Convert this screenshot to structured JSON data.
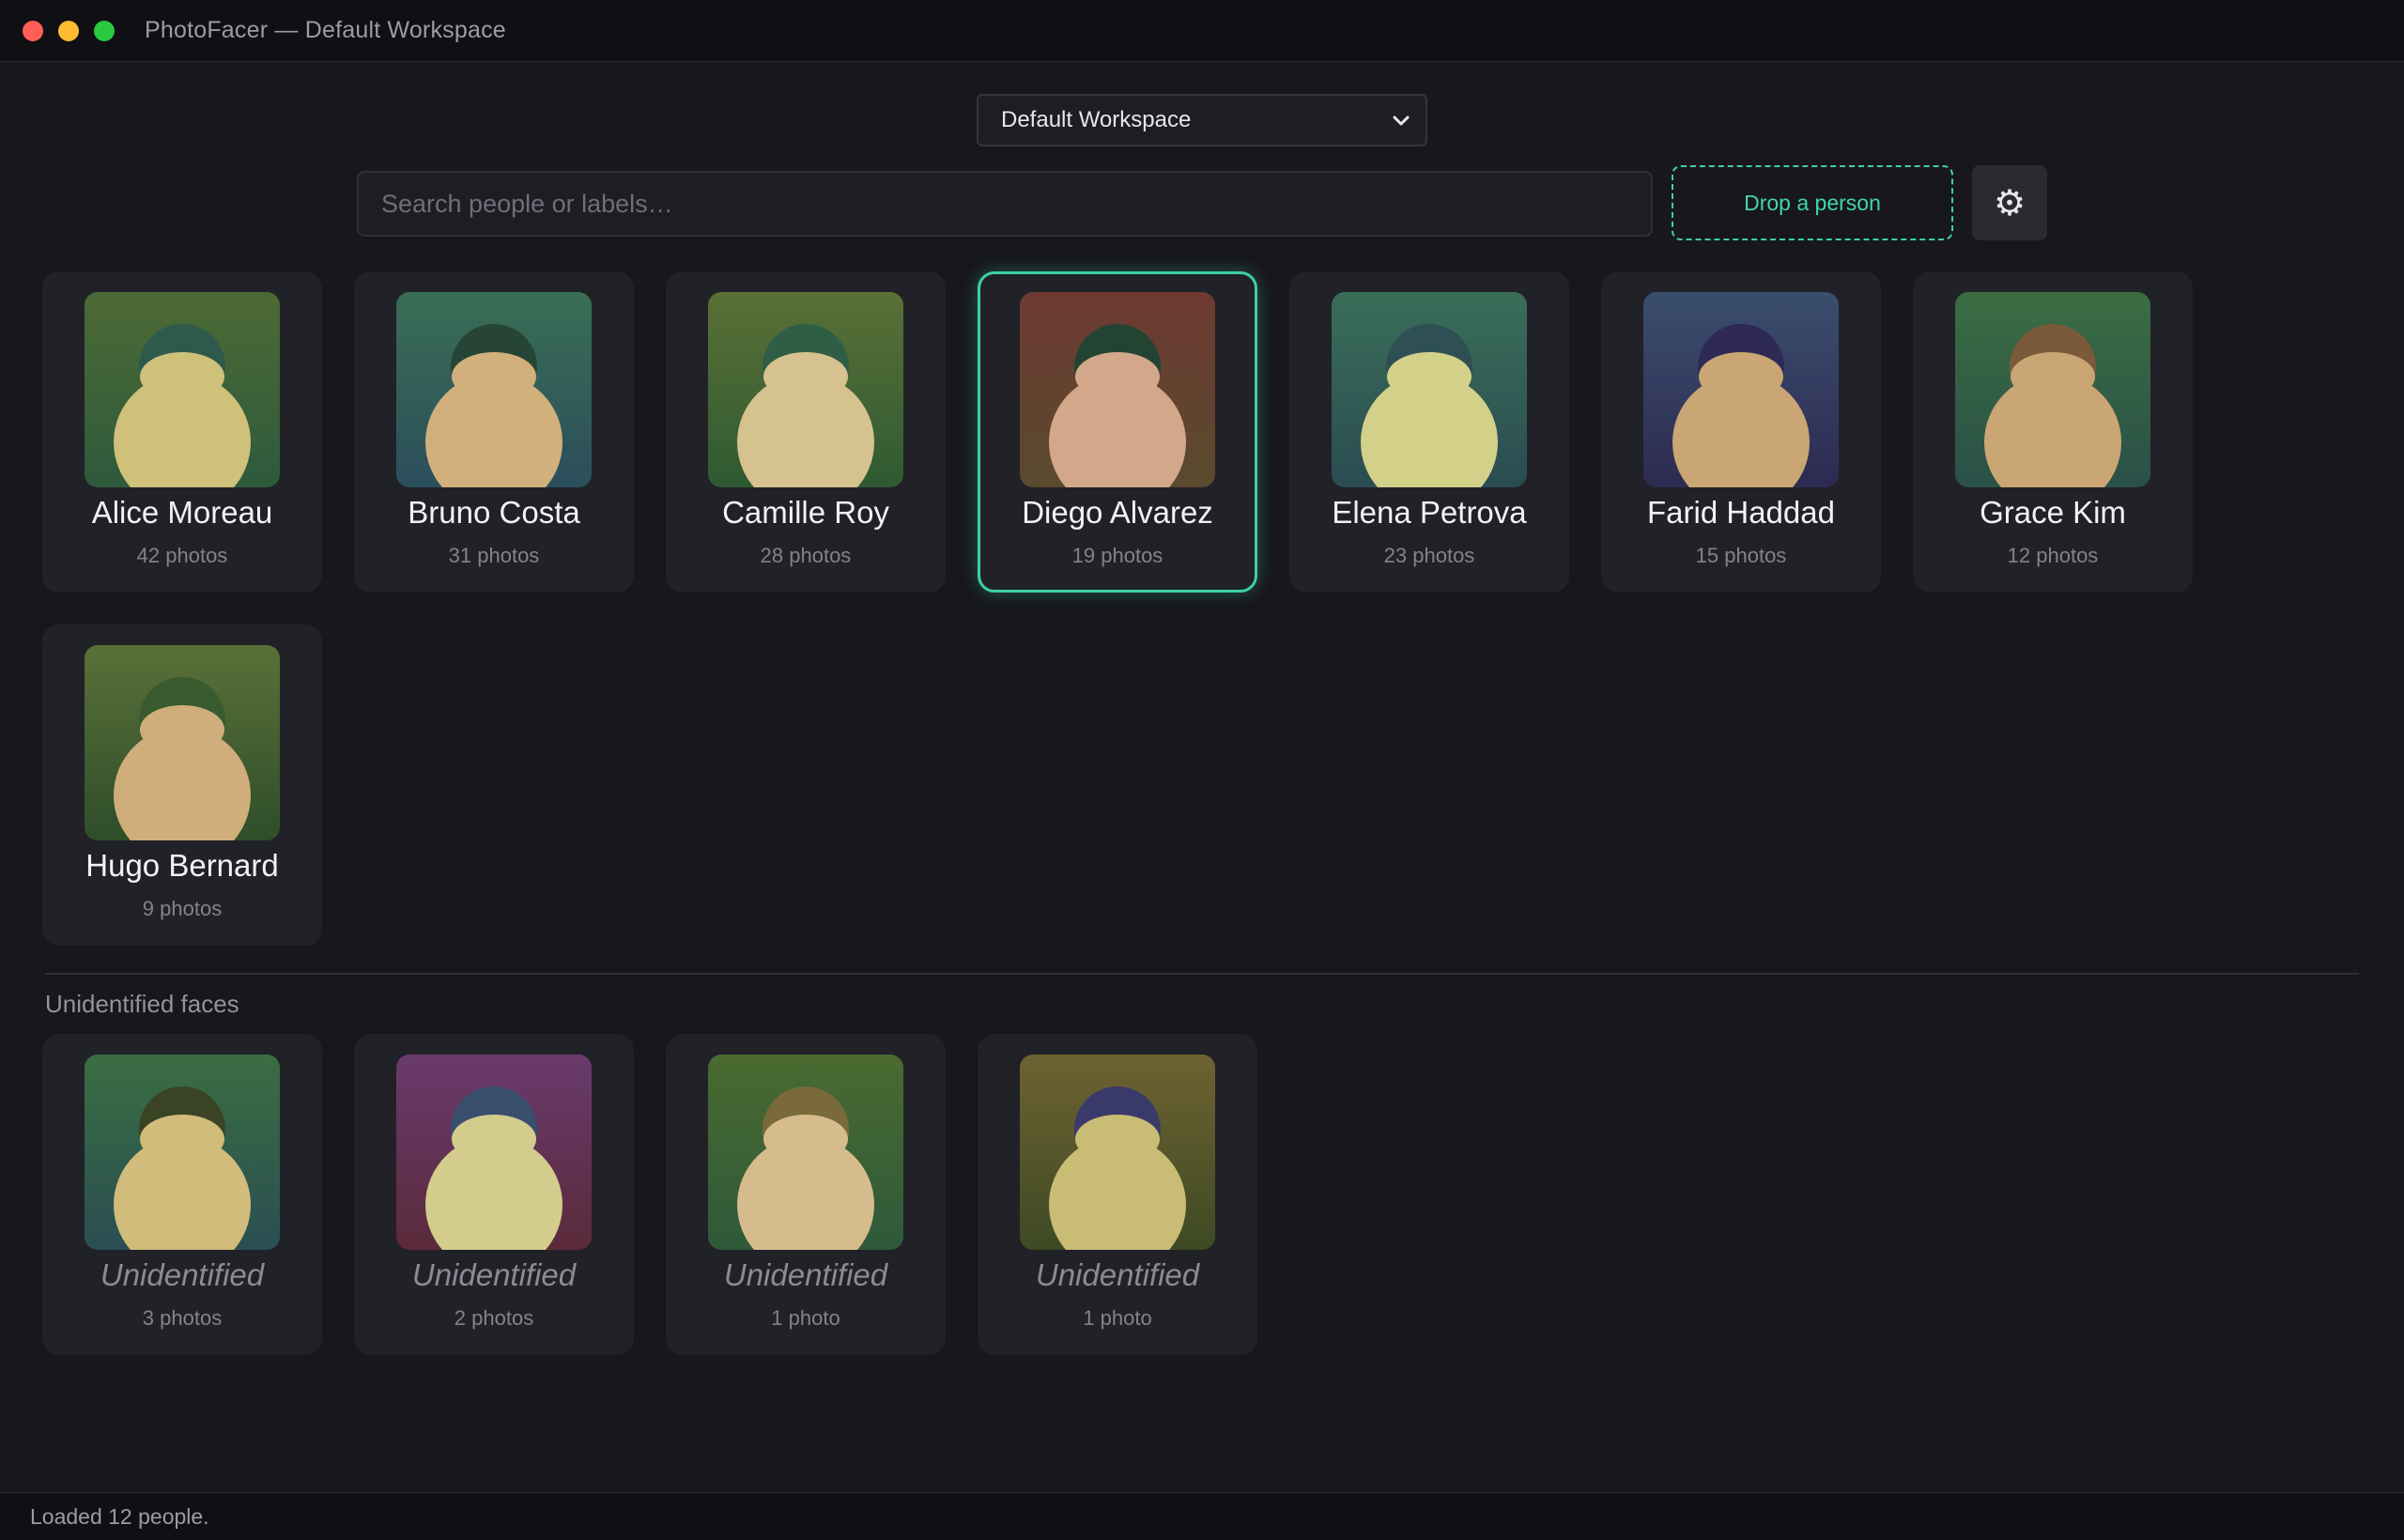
{
  "window": {
    "title": "PhotoFacer — Default Workspace"
  },
  "workspace": {
    "selected": "Default Workspace"
  },
  "search": {
    "placeholder": "Search people or labels…",
    "value": ""
  },
  "drop_zone": {
    "label": "Drop a person"
  },
  "settings": {
    "icon": "gear-icon",
    "glyph": "⚙"
  },
  "accent_color": "#3fd1a0",
  "people": [
    {
      "name": "Alice Moreau",
      "count": "42 photos",
      "colors": {
        "bg_top": "#4d6a35",
        "bg_bottom": "#2d5a3c",
        "hair": "#2d5a4c",
        "face": "#cfc07a"
      }
    },
    {
      "name": "Bruno Costa",
      "count": "31 photos",
      "colors": {
        "bg_top": "#3a6e55",
        "bg_bottom": "#2b4e5c",
        "hair": "#274536",
        "face": "#d1b07c"
      }
    },
    {
      "name": "Camille Roy",
      "count": "28 photos",
      "colors": {
        "bg_top": "#5a7036",
        "bg_bottom": "#2e5a32",
        "hair": "#2e5e45",
        "face": "#d6c28f"
      }
    },
    {
      "name": "Diego Alvarez",
      "count": "19 photos",
      "selected": true,
      "colors": {
        "bg_top": "#6e3a32",
        "bg_bottom": "#594a2e",
        "hair": "#234433",
        "face": "#d3a88a"
      }
    },
    {
      "name": "Elena Petrova",
      "count": "23 photos",
      "colors": {
        "bg_top": "#3a6e58",
        "bg_bottom": "#2a4c52",
        "hair": "#2e5055",
        "face": "#d3d08a"
      }
    },
    {
      "name": "Farid Haddad",
      "count": "15 photos",
      "colors": {
        "bg_top": "#3a4e6e",
        "bg_bottom": "#2e2a52",
        "hair": "#2e2a55",
        "face": "#c9a674"
      }
    },
    {
      "name": "Grace Kim",
      "count": "12 photos",
      "colors": {
        "bg_top": "#3a6e42",
        "bg_bottom": "#2a5048",
        "hair": "#7a5a3a",
        "face": "#caa674"
      }
    },
    {
      "name": "Hugo Bernard",
      "count": "9 photos",
      "colors": {
        "bg_top": "#5a7038",
        "bg_bottom": "#2e4e2a",
        "hair": "#3a5a30",
        "face": "#cfae7c"
      }
    }
  ],
  "unidentified_section": {
    "title": "Unidentified faces"
  },
  "unidentified": [
    {
      "name": "Unidentified",
      "count": "3 photos",
      "colors": {
        "bg_top": "#3a6e42",
        "bg_bottom": "#2a4e52",
        "hair": "#3a4424",
        "face": "#d1bc7c"
      }
    },
    {
      "name": "Unidentified",
      "count": "2 photos",
      "colors": {
        "bg_top": "#6a3a6e",
        "bg_bottom": "#5a2a3a",
        "hair": "#3a4e6e",
        "face": "#d3cc8c"
      }
    },
    {
      "name": "Unidentified",
      "count": "1 photo",
      "colors": {
        "bg_top": "#4a6a30",
        "bg_bottom": "#2e5a3a",
        "hair": "#7a6a3a",
        "face": "#d6bc8c"
      }
    },
    {
      "name": "Unidentified",
      "count": "1 photo",
      "colors": {
        "bg_top": "#6e6232",
        "bg_bottom": "#3e4a24",
        "hair": "#3a3a6a",
        "face": "#c9bc74"
      }
    }
  ],
  "status": {
    "text": "Loaded 12 people."
  }
}
